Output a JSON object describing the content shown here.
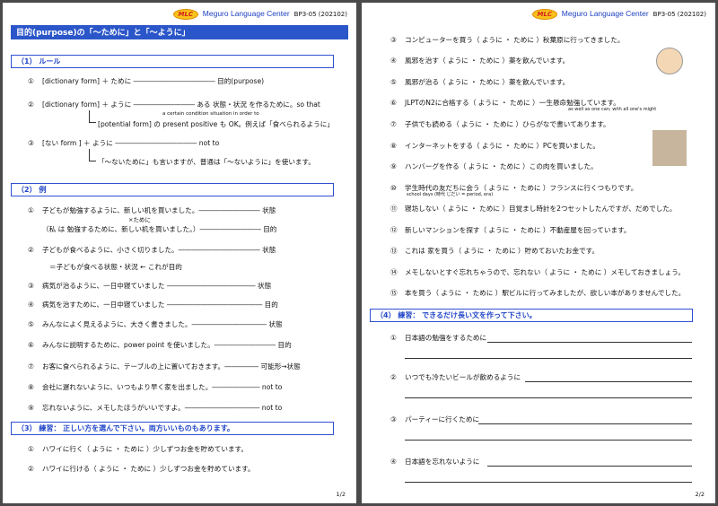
{
  "header": {
    "logo": "MLC",
    "center": "Meguro Language Center",
    "code": "BP3-05 (202102)"
  },
  "page1": {
    "title": "目的(purpose)の「～ために」と「～ように」",
    "sec1": "（1） ルール",
    "rules": [
      {
        "num": "①",
        "text": "[dictionary form] ＋ ために ―――――――――――― 目的(purpose)"
      },
      {
        "num": "②",
        "text": "[dictionary form] ＋ ように ――――――――― ある 状態・状況 を作るために。so that"
      },
      {
        "num": "",
        "text": "a certain condition situation in order to"
      },
      {
        "num": "",
        "text": "[potential form] の present positive も OK。例えば「食べられるように」"
      },
      {
        "num": "③",
        "text": "[ない form ] ＋ ように ―――――――――――― not to"
      },
      {
        "num": "",
        "text": "「～ないために」も言いますが、普通は「～ないように」を使います。"
      }
    ],
    "sec2": "（2） 例",
    "examples": [
      {
        "num": "①",
        "text": "子どもが勉強するように、新しい机を買いました。――――――――― 状態"
      },
      {
        "num": "",
        "text": "×ために"
      },
      {
        "num": "",
        "text": "（私 は 勉強するために、新しい机を買いました。）――――――――― 目的"
      },
      {
        "num": "②",
        "text": "子どもが食べるように、小さく切りました。―――――――――――― 状態"
      },
      {
        "num": "",
        "text": "＝子どもが食べる状態・状況 ← これが目的"
      },
      {
        "num": "③",
        "text": "病気が治るように、一日中寝ていました ――――――――――――― 状態"
      },
      {
        "num": "④",
        "text": "病気を治すために、一日中寝ていました ―――――――――――――― 目的"
      },
      {
        "num": "⑤",
        "text": "みんなによく見えるように、大きく書きました。――――――――――― 状態"
      },
      {
        "num": "⑥",
        "text": "みんなに説明するために、power point を使いました。――――――――― 目的"
      },
      {
        "num": "⑦",
        "text": "お客に食べられるように、テーブルの上に置いておきます。――――― 可能形→状態"
      },
      {
        "num": "⑧",
        "text": "会社に遅れないように、いつもより早く家を出ました。――――――― not to"
      },
      {
        "num": "⑨",
        "text": "忘れないように、メモしたほうがいいですよ。――――――――――― not to"
      }
    ],
    "sec3": "（3） 練習： 正しい方を選んで下さい。両方いいものもあります。",
    "practice": [
      {
        "num": "①",
        "text": "ハワイに行く（ ように ・ ために ）少しずつお金を貯めています。"
      },
      {
        "num": "②",
        "text": "ハワイに行ける（ ように ・ ために ）少しずつお金を貯めています。"
      }
    ],
    "pagenum": "1/2"
  },
  "page2": {
    "items": [
      {
        "num": "③",
        "text": "コンピューターを買う（ ように ・ ために ）秋葉原に行ってきました。"
      },
      {
        "num": "④",
        "text": "風邪を治す（ ように ・ ために ）薬を飲んでいます。"
      },
      {
        "num": "⑤",
        "text": "風邪が治る（ ように ・ ために ）薬を飲んでいます。"
      },
      {
        "num": "⑥",
        "text": "JLPTのN2に合格する（ ように ・ ために ）一生懸命勉強しています。"
      },
      {
        "num": "",
        "text": "as well as one can; with all one's might"
      },
      {
        "num": "⑦",
        "text": "子供でも読める（ ように ・ ために ）ひらがなで書いてあります。"
      },
      {
        "num": "⑧",
        "text": "インターネットをする（ ように ・ ために ）PCを買いました。"
      },
      {
        "num": "⑨",
        "text": "ハンバーグを作る（ ように ・ ために ）この肉を買いました。"
      },
      {
        "num": "⑩",
        "text": "学生時代の友だちに会う（ ように ・ ために ）フランスに行くつもりです。"
      },
      {
        "num": "",
        "text": "school days (時代 じだい = period, era)"
      },
      {
        "num": "⑪",
        "text": "寝坊しない（ ように ・ ために ）目覚まし時計を2つセットしたんですが、だめでした。"
      },
      {
        "num": "⑫",
        "text": "新しいマンションを探す（ ように ・ ために ）不動産屋を回っています。"
      },
      {
        "num": "⑬",
        "text": "これは 家を買う（ ように ・ ために ）貯めておいたお金です。"
      },
      {
        "num": "⑭",
        "text": "メモしないとすぐ忘れちゃうので、忘れない（ ように ・ ために ）メモしておきましょう。"
      },
      {
        "num": "⑮",
        "text": "本を買う（ ように ・ ために ）駅ビルに行ってみましたが、欲しい本がありませんでした。"
      }
    ],
    "sec4": "（4） 練習： できるだけ長い文を作って下さい。",
    "writing": [
      {
        "num": "①",
        "text": "日本語の勉強をするために"
      },
      {
        "num": "②",
        "text": "いつでも冷たいビールが飲めるように"
      },
      {
        "num": "③",
        "text": "パーティーに行くために"
      },
      {
        "num": "④",
        "text": "日本語を忘れないように"
      }
    ],
    "pagenum": "2/2"
  }
}
